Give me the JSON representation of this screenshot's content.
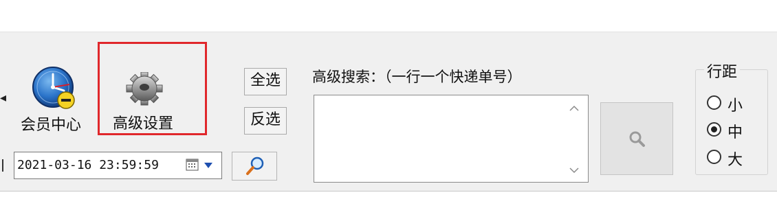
{
  "toolbar": {
    "member_center_label": "会员中心",
    "advanced_settings_label": "高级设置",
    "select_all_label": "全选",
    "invert_select_label": "反选"
  },
  "date_filter": {
    "datetime_value": "2021-03-16 23:59:59"
  },
  "advanced_search": {
    "label": "高级搜索：（一行一个快递单号）",
    "textarea_value": ""
  },
  "line_spacing": {
    "title": "行距",
    "options": [
      {
        "label": "小",
        "selected": false
      },
      {
        "label": "中",
        "selected": true
      },
      {
        "label": "大",
        "selected": false
      }
    ]
  },
  "colors": {
    "highlight_border": "#e0272b",
    "toolbar_bg": "#f0f0f0"
  }
}
